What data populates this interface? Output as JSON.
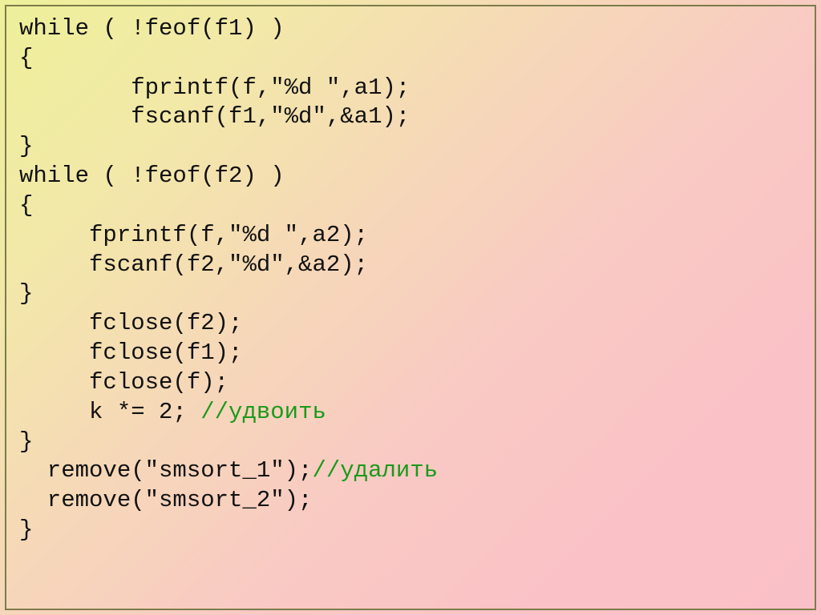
{
  "code": {
    "l1": "while ( !feof(f1) )",
    "l2": "{",
    "l3": "        fprintf(f,\"%d \",a1);",
    "l4": "        fscanf(f1,\"%d\",&a1);",
    "l5": "}",
    "l6": "while ( !feof(f2) )",
    "l7": "{",
    "l8": "     fprintf(f,\"%d \",a2);",
    "l9": "     fscanf(f2,\"%d\",&a2);",
    "l10": "}",
    "l11": "     fclose(f2);",
    "l12": "     fclose(f1);",
    "l13": "     fclose(f);",
    "l14a": "     k *= 2; ",
    "l14b": "//удвоить",
    "l15": "}",
    "l16a": "  remove(\"smsort_1\");",
    "l16b": "//удалить",
    "l17": "  remove(\"smsort_2\");",
    "l18": "}"
  }
}
